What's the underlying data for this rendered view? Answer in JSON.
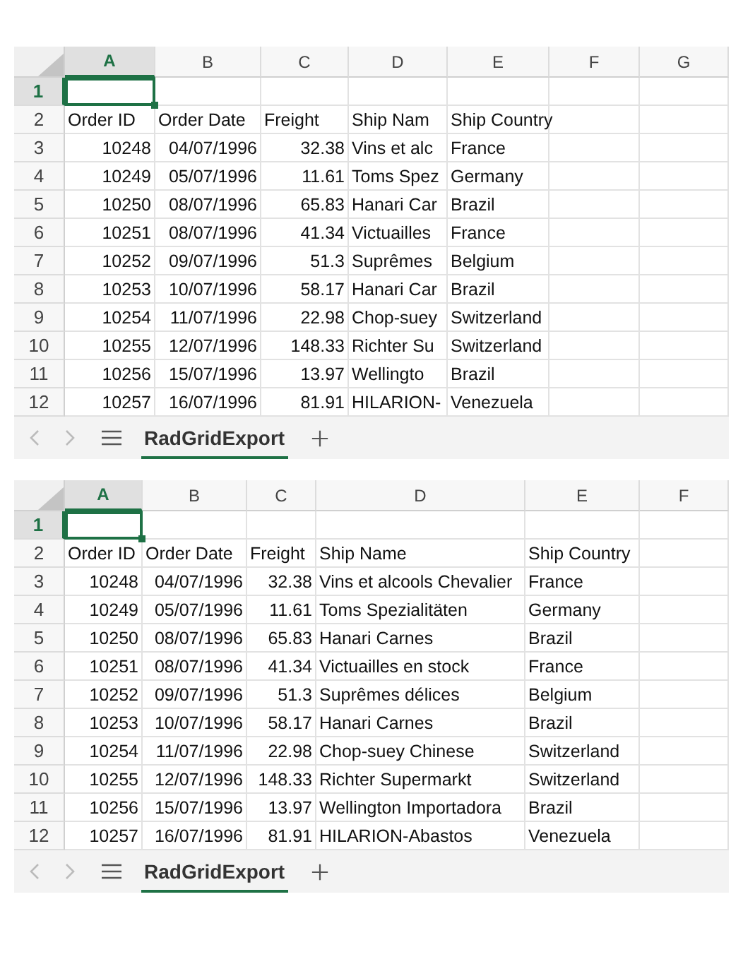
{
  "sheets": [
    {
      "columns": [
        {
          "label": "A",
          "selected": true
        },
        {
          "label": "B",
          "selected": false
        },
        {
          "label": "C",
          "selected": false
        },
        {
          "label": "D",
          "selected": false
        },
        {
          "label": "E",
          "selected": false
        },
        {
          "label": "F",
          "selected": false
        },
        {
          "label": "G",
          "selected": false
        }
      ],
      "rows": [
        {
          "number": "1",
          "selected": true,
          "cells": []
        },
        {
          "number": "2",
          "selected": false,
          "cells": [
            "Order ID",
            "Order Date",
            "Freight",
            "Ship Nam",
            "Ship Country"
          ]
        },
        {
          "number": "3",
          "selected": false,
          "cells": [
            "10248",
            "04/07/1996",
            "32.38",
            "Vins et alc",
            "France"
          ]
        },
        {
          "number": "4",
          "selected": false,
          "cells": [
            "10249",
            "05/07/1996",
            "11.61",
            "Toms Spez",
            "Germany"
          ]
        },
        {
          "number": "5",
          "selected": false,
          "cells": [
            "10250",
            "08/07/1996",
            "65.83",
            "Hanari Car",
            "Brazil"
          ]
        },
        {
          "number": "6",
          "selected": false,
          "cells": [
            "10251",
            "08/07/1996",
            "41.34",
            "Victuailles",
            "France"
          ]
        },
        {
          "number": "7",
          "selected": false,
          "cells": [
            "10252",
            "09/07/1996",
            "51.3",
            "Suprêmes",
            "Belgium"
          ]
        },
        {
          "number": "8",
          "selected": false,
          "cells": [
            "10253",
            "10/07/1996",
            "58.17",
            "Hanari Car",
            "Brazil"
          ]
        },
        {
          "number": "9",
          "selected": false,
          "cells": [
            "10254",
            "11/07/1996",
            "22.98",
            "Chop-suey",
            "Switzerland"
          ]
        },
        {
          "number": "10",
          "selected": false,
          "cells": [
            "10255",
            "12/07/1996",
            "148.33",
            "Richter Su",
            "Switzerland"
          ]
        },
        {
          "number": "11",
          "selected": false,
          "cells": [
            "10256",
            "15/07/1996",
            "13.97",
            "Wellingto",
            "Brazil"
          ]
        },
        {
          "number": "12",
          "selected": false,
          "cells": [
            "10257",
            "16/07/1996",
            "81.91",
            "HILARION-",
            "Venezuela"
          ]
        }
      ],
      "tabs": [
        {
          "label": "RadGridExport",
          "selected": true
        }
      ]
    },
    {
      "columns": [
        {
          "label": "A",
          "selected": true
        },
        {
          "label": "B",
          "selected": false
        },
        {
          "label": "C",
          "selected": false
        },
        {
          "label": "D",
          "selected": false
        },
        {
          "label": "E",
          "selected": false
        },
        {
          "label": "F",
          "selected": false
        }
      ],
      "rows": [
        {
          "number": "1",
          "selected": true,
          "cells": []
        },
        {
          "number": "2",
          "selected": false,
          "cells": [
            "Order ID",
            "Order Date",
            "Freight",
            "Ship Name",
            "Ship Country"
          ]
        },
        {
          "number": "3",
          "selected": false,
          "cells": [
            "10248",
            "04/07/1996",
            "32.38",
            "Vins et alcools Chevalier",
            "France"
          ]
        },
        {
          "number": "4",
          "selected": false,
          "cells": [
            "10249",
            "05/07/1996",
            "11.61",
            "Toms Spezialitäten",
            "Germany"
          ]
        },
        {
          "number": "5",
          "selected": false,
          "cells": [
            "10250",
            "08/07/1996",
            "65.83",
            "Hanari Carnes",
            "Brazil"
          ]
        },
        {
          "number": "6",
          "selected": false,
          "cells": [
            "10251",
            "08/07/1996",
            "41.34",
            "Victuailles en stock",
            "France"
          ]
        },
        {
          "number": "7",
          "selected": false,
          "cells": [
            "10252",
            "09/07/1996",
            "51.3",
            "Suprêmes délices",
            "Belgium"
          ]
        },
        {
          "number": "8",
          "selected": false,
          "cells": [
            "10253",
            "10/07/1996",
            "58.17",
            "Hanari Carnes",
            "Brazil"
          ]
        },
        {
          "number": "9",
          "selected": false,
          "cells": [
            "10254",
            "11/07/1996",
            "22.98",
            "Chop-suey Chinese",
            "Switzerland"
          ]
        },
        {
          "number": "10",
          "selected": false,
          "cells": [
            "10255",
            "12/07/1996",
            "148.33",
            "Richter Supermarkt",
            "Switzerland"
          ]
        },
        {
          "number": "11",
          "selected": false,
          "cells": [
            "10256",
            "15/07/1996",
            "13.97",
            "Wellington Importadora",
            "Brazil"
          ]
        },
        {
          "number": "12",
          "selected": false,
          "cells": [
            "10257",
            "16/07/1996",
            "81.91",
            "HILARION-Abastos",
            "Venezuela"
          ]
        }
      ],
      "tabs": [
        {
          "label": "RadGridExport",
          "selected": true
        }
      ]
    }
  ]
}
